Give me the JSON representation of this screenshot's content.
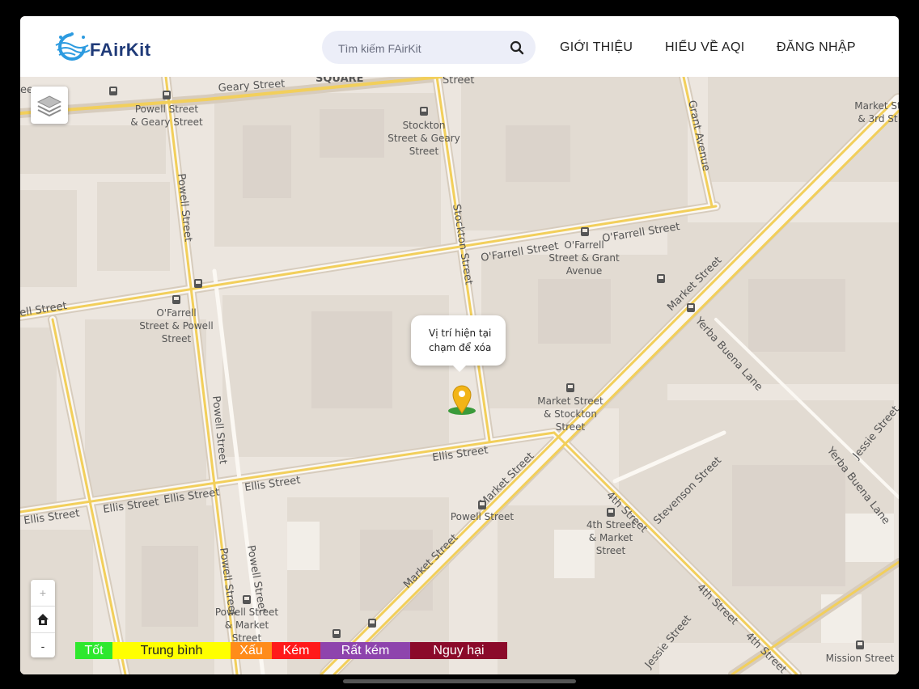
{
  "app": {
    "brand": "FAirKit"
  },
  "header": {
    "search": {
      "placeholder": "Tìm kiếm FAirKit"
    },
    "nav": [
      {
        "label": "GIỚI THIỆU"
      },
      {
        "label": "HIỂU VỀ AQI"
      },
      {
        "label": "ĐĂNG NHẬP"
      }
    ]
  },
  "map": {
    "streets": {
      "geary": "Geary Street",
      "square": "SQUARE",
      "street_top": "Street",
      "grant": "Grant Avenue",
      "powell_1": "Powell Street",
      "stockton": "Stockton Street",
      "ofarrell_1": "O'Farrell Street",
      "ofarrell_2": "O'Farrell Street",
      "ofarrell_left": "ell Street",
      "ellis_1": "Ellis Street",
      "ellis_2": "Ellis Street",
      "ellis_3": "Ellis Street",
      "ellis_4": "Ellis Street",
      "ellis_5": "Ellis Street",
      "powell_2": "Powell Street",
      "powell_3": "Powell Street",
      "powell_4": "Powell Street",
      "market_1": "Market Street",
      "market_2": "Market Street",
      "market_3": "Market Street",
      "fourth_1": "4th Street",
      "fourth_2": "4th Street",
      "fourth_3": "4th Street",
      "stevenson": "Stevenson Street",
      "yerba_1": "Yerba Buena Lane",
      "yerba_2": "Yerba Buena Lane",
      "jessie_1": "Jessie Street",
      "jessie_2": "Jessie Street",
      "edge_ee": "ee"
    },
    "stops": {
      "powell_geary": [
        "Powell Street",
        "& Geary Street"
      ],
      "stockton_geary": [
        "Stockton",
        "Street & Geary",
        "Street"
      ],
      "ofarrell_grant": [
        "O'Farrell",
        "Street & Grant",
        "Avenue"
      ],
      "ofarrell_powell": [
        "O'Farrell",
        "Street & Powell",
        "Street"
      ],
      "market_stockton": [
        "Market Street",
        "& Stockton",
        "Street"
      ],
      "powell_station": [
        "Powell Street"
      ],
      "fourth_market": [
        "4th Street",
        "& Market",
        "Street"
      ],
      "powell_market": [
        "Powell Street",
        "& Market",
        "Street"
      ],
      "market_third": [
        "Market St",
        "& 3rd St"
      ],
      "mission": [
        "Mission Street"
      ]
    },
    "popup": {
      "line1": "Vị trí hiện tại",
      "line2": "chạm để xóa"
    },
    "zoom": {
      "in": "+",
      "home_icon": "home-icon",
      "out": "-"
    },
    "layers_icon": "layers-icon",
    "marker_color": "#f2b417"
  },
  "legend": [
    {
      "label": "Tốt",
      "color": "#2ee82e",
      "text_color": "#ffffff"
    },
    {
      "label": "Trung bình",
      "color": "#ffff00",
      "text_color": "#222222"
    },
    {
      "label": "Xấu",
      "color": "#ff8c1a",
      "text_color": "#ffffff"
    },
    {
      "label": "Kém",
      "color": "#ff1a1a",
      "text_color": "#ffffff"
    },
    {
      "label": "Rất kém",
      "color": "#8e44ad",
      "text_color": "#ffffff"
    },
    {
      "label": "Nguy hại",
      "color": "#8b0a2a",
      "text_color": "#ffffff"
    }
  ]
}
